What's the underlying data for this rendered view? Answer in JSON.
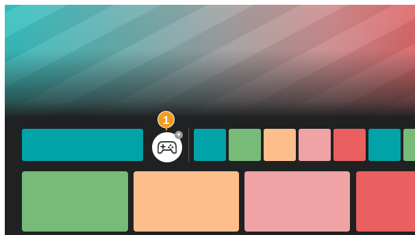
{
  "hero": {
    "colors": {
      "start": "#37c4c4",
      "end": "#e06a6c"
    }
  },
  "app_row": {
    "featured_color": "#00a3a8",
    "game_button": {
      "icon": "gamepad-icon",
      "badge_icon": "plus-icon",
      "badge_symbol": "+"
    },
    "callout": {
      "number": "1",
      "color": "#f29b1e"
    },
    "tile_colors": [
      "#00a3a8",
      "#77bb78",
      "#febe8c",
      "#efa3a5",
      "#ea5f5f",
      "#00a3a8",
      "#77bb78"
    ]
  },
  "content_row": {
    "tile_colors": [
      "#77bb78",
      "#febe8c",
      "#efa3a5",
      "#ea5f5f"
    ]
  }
}
